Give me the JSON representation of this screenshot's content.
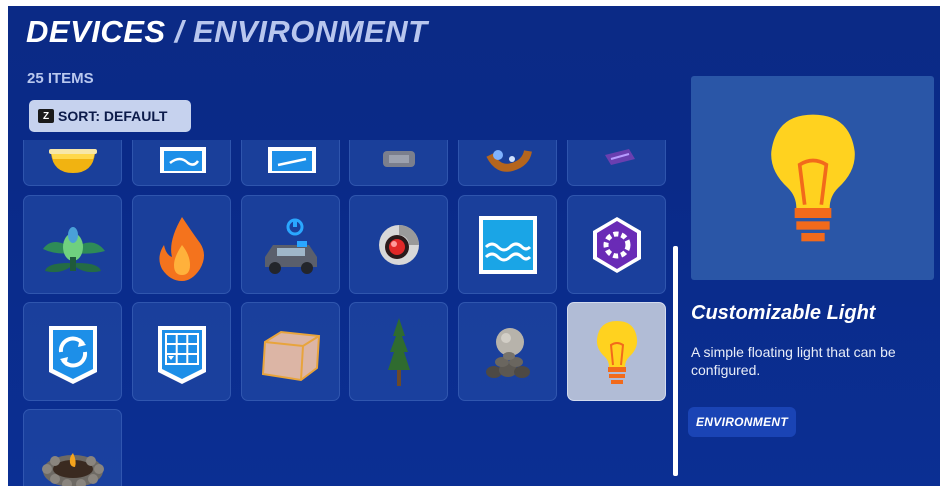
{
  "header": {
    "title_main": "DEVICES",
    "separator": "/",
    "title_category": "ENVIRONMENT"
  },
  "item_count": "25 ITEMS",
  "sort_button": {
    "key_hint": "Z",
    "label": "SORT: DEFAULT"
  },
  "grid": {
    "items": [
      {
        "icon": "yellow-jar-icon"
      },
      {
        "icon": "blue-sign-icon"
      },
      {
        "icon": "blue-board-icon"
      },
      {
        "icon": "gray-device-icon"
      },
      {
        "icon": "crystal-creature-icon"
      },
      {
        "icon": "purple-pad-icon"
      },
      {
        "icon": "carnivorous-plant-icon"
      },
      {
        "icon": "fire-icon"
      },
      {
        "icon": "vehicle-spawner-icon"
      },
      {
        "icon": "red-eye-sentry-icon"
      },
      {
        "icon": "water-icon"
      },
      {
        "icon": "purple-gear-cube-icon"
      },
      {
        "icon": "refresh-badge-icon"
      },
      {
        "icon": "grid-badge-icon"
      },
      {
        "icon": "glass-volume-icon"
      },
      {
        "icon": "pine-tree-icon"
      },
      {
        "icon": "rock-pile-icon"
      },
      {
        "icon": "light-bulb-icon",
        "selected": true
      },
      {
        "icon": "campfire-icon"
      }
    ]
  },
  "details": {
    "name": "Customizable Light",
    "description": "A simple floating light that can be configured.",
    "tag": "ENVIRONMENT",
    "preview_icon": "light-bulb-icon"
  },
  "colors": {
    "background": "#0b2a86",
    "tile": "#1f4aa6",
    "selected_tile": "#b1bcd6",
    "bulb_yellow": "#ffd21f",
    "bulb_orange": "#f26a1b",
    "tag_bg": "#1a44b5"
  }
}
